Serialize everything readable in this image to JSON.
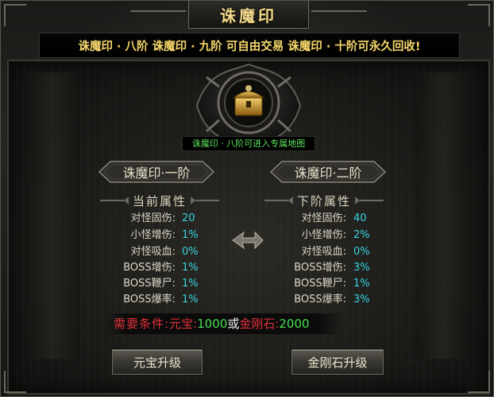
{
  "window": {
    "title": "诛魔印"
  },
  "announcement": "诛魔印 · 八阶  诛魔印 · 九阶 可自由交易  诛魔印 · 十阶可永久回收!",
  "hint": "诛魔印 · 八阶可进入专属地图",
  "current_tier": "诛魔印·一阶",
  "next_tier": "诛魔印·二阶",
  "current_attrs_title": "当前属性",
  "next_attrs_title": "下阶属性",
  "current_attrs": [
    {
      "label": "对怪固伤:",
      "value": "20"
    },
    {
      "label": "小怪增伤:",
      "value": "1%"
    },
    {
      "label": "对怪吸血:",
      "value": "0%"
    },
    {
      "label": "BOSS增伤:",
      "value": "1%"
    },
    {
      "label": "BOSS鞭尸:",
      "value": "1%"
    },
    {
      "label": "BOSS爆率:",
      "value": "1%"
    }
  ],
  "next_attrs": [
    {
      "label": "对怪固伤:",
      "value": "40"
    },
    {
      "label": "小怪增伤:",
      "value": "2%"
    },
    {
      "label": "对怪吸血:",
      "value": "0%"
    },
    {
      "label": "BOSS增伤:",
      "value": "3%"
    },
    {
      "label": "BOSS鞭尸:",
      "value": "1%"
    },
    {
      "label": "BOSS爆率:",
      "value": "3%"
    }
  ],
  "condition": {
    "label": "需要条件:",
    "yuanbao_label": "元宝:",
    "yuanbao_value": "1000",
    "or": "或",
    "jingang_label": "金刚石:",
    "jingang_value": "2000"
  },
  "buttons": {
    "yuanbao_upgrade": "元宝升级",
    "jingang_upgrade": "金刚石升级"
  },
  "colors": {
    "accent_gold": "#f4d66a",
    "attr_value": "#37d4e0",
    "hint_green": "#5ce05c",
    "cond_red": "#e0303a",
    "cond_green": "#45e050"
  }
}
